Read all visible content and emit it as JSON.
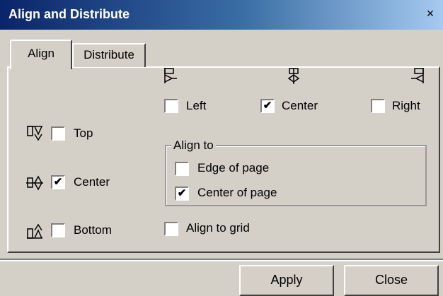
{
  "window": {
    "title": "Align and Distribute",
    "close_label": "×"
  },
  "tabs": [
    {
      "label": "Align",
      "active": true
    },
    {
      "label": "Distribute",
      "active": false
    }
  ],
  "horizontal": {
    "left": {
      "label": "Left",
      "checked": false,
      "icon": "align-left-icon"
    },
    "center": {
      "label": "Center",
      "checked": true,
      "icon": "align-center-horizontal-icon"
    },
    "right": {
      "label": "Right",
      "checked": false,
      "icon": "align-right-icon"
    }
  },
  "vertical": {
    "top": {
      "label": "Top",
      "checked": false,
      "icon": "align-top-icon"
    },
    "center": {
      "label": "Center",
      "checked": true,
      "icon": "align-center-vertical-icon"
    },
    "bottom": {
      "label": "Bottom",
      "checked": false,
      "icon": "align-bottom-icon"
    }
  },
  "align_to": {
    "legend": "Align to",
    "edge_of_page": {
      "label": "Edge of page",
      "checked": false
    },
    "center_of_page": {
      "label": "Center of page",
      "checked": true
    }
  },
  "align_to_grid": {
    "label": "Align to grid",
    "checked": false
  },
  "buttons": {
    "apply": "Apply",
    "close": "Close"
  },
  "check_mark": "✔"
}
